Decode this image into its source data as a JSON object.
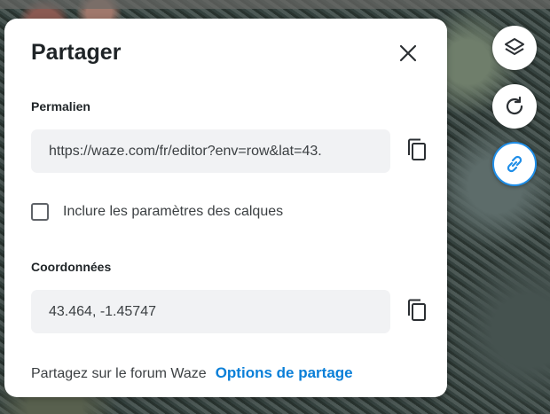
{
  "panel": {
    "title": "Partager",
    "permalink": {
      "label": "Permalien",
      "value": "https://waze.com/fr/editor?env=row&lat=43."
    },
    "layers_checkbox": {
      "label": "Inclure les paramètres des calques",
      "checked": false
    },
    "coordinates": {
      "label": "Coordonnées",
      "value": "43.464, -1.45747"
    },
    "footer": {
      "text": "Partagez sur le forum Waze",
      "link": "Options de partage"
    }
  },
  "map_controls": [
    {
      "icon": "layers-icon",
      "active": false
    },
    {
      "icon": "refresh-icon",
      "active": false
    },
    {
      "icon": "link-icon",
      "active": true
    }
  ],
  "colors": {
    "accent": "#0a7fd8",
    "field_bg": "#f1f2f4",
    "active_border": "#1f8ee8"
  }
}
